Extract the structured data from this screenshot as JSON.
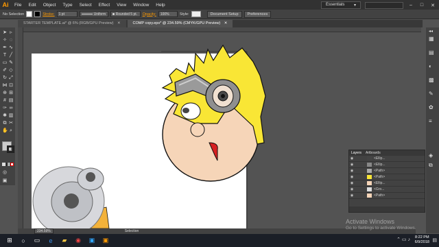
{
  "app": {
    "logo": "Ai"
  },
  "menu": [
    "File",
    "Edit",
    "Object",
    "Type",
    "Select",
    "Effect",
    "View",
    "Window",
    "Help"
  ],
  "workspace": {
    "label": "Essentials",
    "chevron": "▾"
  },
  "window_controls": {
    "minimize": "–",
    "maximize": "□",
    "close": "✕"
  },
  "control_bar": {
    "selection": "No Selection",
    "stroke_label": "Stroke:",
    "stroke_weight": "1 pt",
    "profile": "Uniform",
    "brush": "Rounded 5 pt.",
    "opacity_label": "Opacity:",
    "opacity_value": "100%",
    "style_label": "Style:",
    "doc_setup": "Document Setup",
    "preferences": "Preferences"
  },
  "tabs": [
    {
      "label": "STARTER TEMPLATE.ai* @ 6% (RGB/GPU Preview)",
      "close": "✕"
    },
    {
      "label": "COMP copy.eps* @ 234.59% (CMYK/GPU Preview)",
      "close": "✕"
    }
  ],
  "layers_panel": {
    "tab_layers": "Layers",
    "tab_artboards": "Artboards",
    "rows": [
      "<Ellip...",
      "<Ellip...",
      "<Path>",
      "<Path>",
      "<Ellip...",
      "<Gro...",
      "<Path>"
    ]
  },
  "status": {
    "zoom": "234.59%",
    "tool": "Selection"
  },
  "watermark": {
    "title": "Activate Windows",
    "subtitle": "Go to Settings to activate Windows."
  },
  "clock": {
    "time": "8:22 PM",
    "date": "6/9/2018"
  },
  "colors": {
    "accent": "#ff9a00",
    "hair": "#f9e635",
    "skin": "#f6d5b8",
    "nose": "#d62020",
    "artboard": "#ffffff",
    "workspace": "#535353"
  }
}
